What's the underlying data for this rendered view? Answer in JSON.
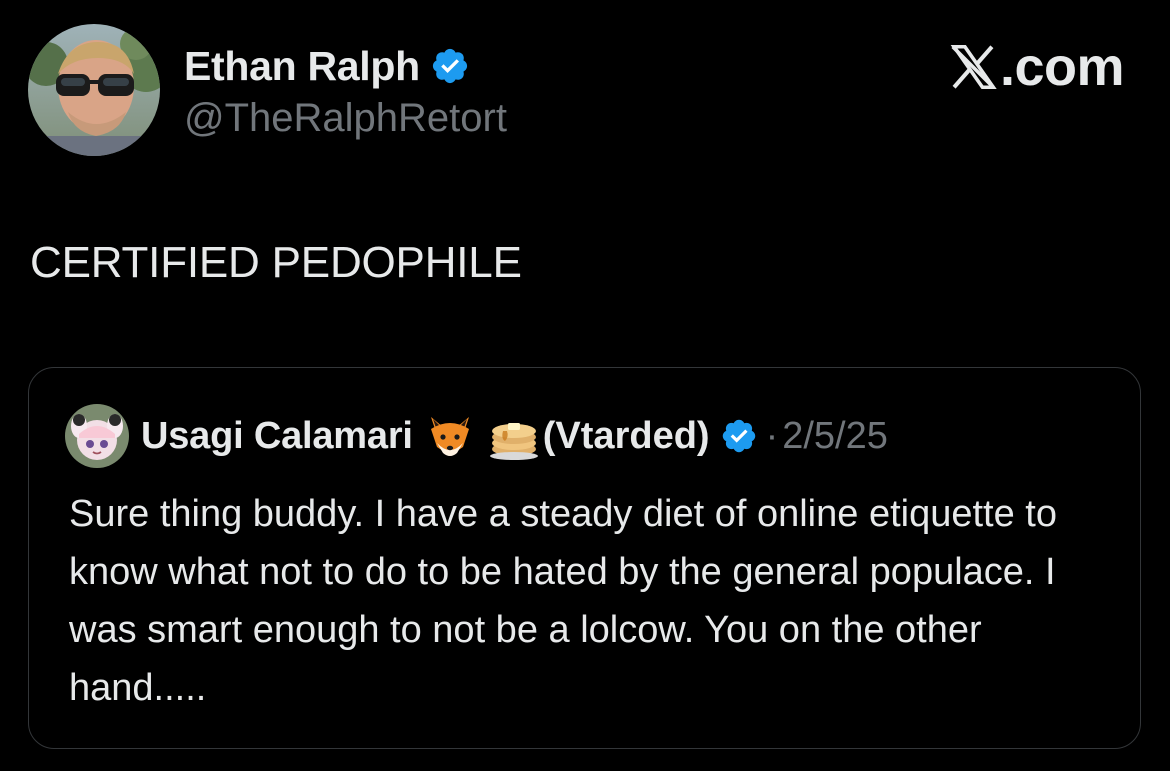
{
  "author": {
    "display_name": "Ethan Ralph",
    "handle": "@TheRalphRetort",
    "verified": true,
    "avatar_icon": "profile-photo"
  },
  "brand": {
    "logo_icon": "x-logo-icon",
    "text": ".com"
  },
  "post": {
    "text": "CERTIFIED PEDOPHILE"
  },
  "quoted_post": {
    "display_name": "Usagi Calamari",
    "emojis": [
      "fox-emoji",
      "pancakes-emoji"
    ],
    "name_suffix": "(Vtarded)",
    "verified": true,
    "separator": "·",
    "date": "2/5/25",
    "body": "Sure thing buddy. I have a steady diet of online etiquette to know what not to do to be hated by the general populace. I was smart enough to not be a lolcow. You on the other hand....."
  },
  "colors": {
    "background": "#000000",
    "primary_text": "#e7e9ea",
    "secondary_text": "#71767b",
    "verified_blue": "#1d9bf0",
    "card_border": "#333639"
  }
}
